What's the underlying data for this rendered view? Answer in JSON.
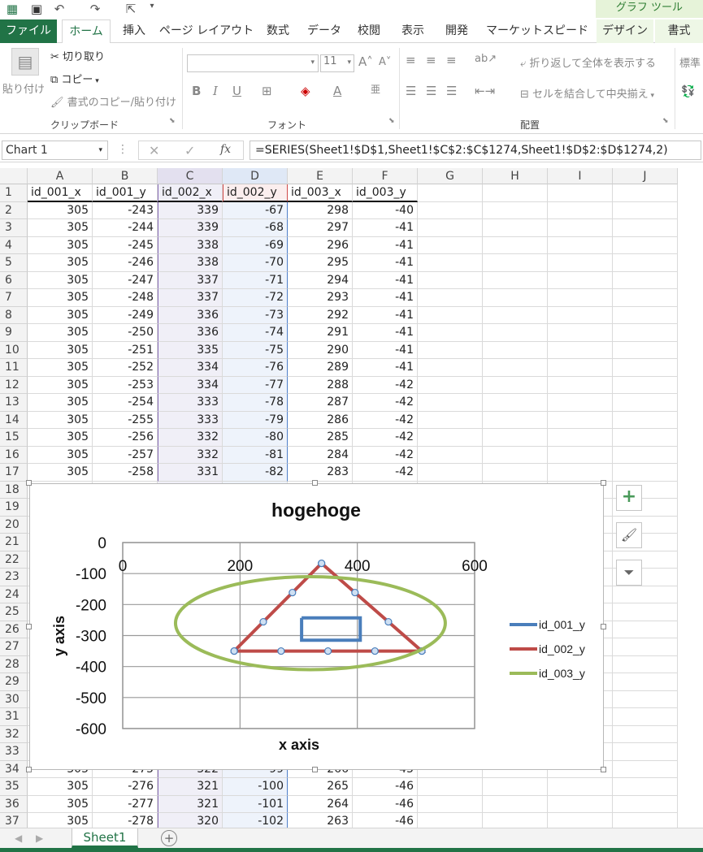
{
  "app": {
    "context_tab_group": "グラフ ツール"
  },
  "ribbon_tabs": [
    "ファイル",
    "ホーム",
    "挿入",
    "ページ レイアウト",
    "数式",
    "データ",
    "校閲",
    "表示",
    "開発",
    "マーケットスピード II",
    "デザイン",
    "書式"
  ],
  "ribbon": {
    "clipboard": {
      "paste": "貼り付け",
      "cut": "切り取り",
      "copy": "コピー",
      "format_painter": "書式のコピー/貼り付け",
      "label": "クリップボード"
    },
    "font": {
      "font_name": "",
      "font_size": "11",
      "label": "フォント"
    },
    "alignment": {
      "wrap_text": "折り返して全体を表示する",
      "merge_center": "セルを結合して中央揃え",
      "label": "配置"
    },
    "number": {
      "format": "標準"
    }
  },
  "formula_bar": {
    "name_box": "Chart 1",
    "fx": "fx",
    "formula": "=SERIES(Sheet1!$D$1,Sheet1!$C$2:$C$1274,Sheet1!$D$2:$D$1274,2)"
  },
  "columns": [
    "A",
    "B",
    "C",
    "D",
    "E",
    "F",
    "G",
    "H",
    "I",
    "J"
  ],
  "headers": [
    "id_001_x",
    "id_001_y",
    "id_002_x",
    "id_002_y",
    "id_003_x",
    "id_003_y"
  ],
  "rows_top": [
    {
      "n": "2",
      "v": [
        "305",
        "-243",
        "339",
        "-67",
        "298",
        "-40"
      ]
    },
    {
      "n": "3",
      "v": [
        "305",
        "-244",
        "339",
        "-68",
        "297",
        "-41"
      ]
    },
    {
      "n": "4",
      "v": [
        "305",
        "-245",
        "338",
        "-69",
        "296",
        "-41"
      ]
    },
    {
      "n": "5",
      "v": [
        "305",
        "-246",
        "338",
        "-70",
        "295",
        "-41"
      ]
    },
    {
      "n": "6",
      "v": [
        "305",
        "-247",
        "337",
        "-71",
        "294",
        "-41"
      ]
    },
    {
      "n": "7",
      "v": [
        "305",
        "-248",
        "337",
        "-72",
        "293",
        "-41"
      ]
    },
    {
      "n": "8",
      "v": [
        "305",
        "-249",
        "336",
        "-73",
        "292",
        "-41"
      ]
    },
    {
      "n": "9",
      "v": [
        "305",
        "-250",
        "336",
        "-74",
        "291",
        "-41"
      ]
    },
    {
      "n": "10",
      "v": [
        "305",
        "-251",
        "335",
        "-75",
        "290",
        "-41"
      ]
    },
    {
      "n": "11",
      "v": [
        "305",
        "-252",
        "334",
        "-76",
        "289",
        "-41"
      ]
    },
    {
      "n": "12",
      "v": [
        "305",
        "-253",
        "334",
        "-77",
        "288",
        "-42"
      ]
    },
    {
      "n": "13",
      "v": [
        "305",
        "-254",
        "333",
        "-78",
        "287",
        "-42"
      ]
    },
    {
      "n": "14",
      "v": [
        "305",
        "-255",
        "333",
        "-79",
        "286",
        "-42"
      ]
    },
    {
      "n": "15",
      "v": [
        "305",
        "-256",
        "332",
        "-80",
        "285",
        "-42"
      ]
    },
    {
      "n": "16",
      "v": [
        "305",
        "-257",
        "332",
        "-81",
        "284",
        "-42"
      ]
    },
    {
      "n": "17",
      "v": [
        "305",
        "-258",
        "331",
        "-82",
        "283",
        "-42"
      ]
    }
  ],
  "rows_hidden_numbers": [
    "18",
    "19",
    "20",
    "21",
    "22",
    "23",
    "24",
    "25",
    "26",
    "27",
    "28",
    "29",
    "30",
    "31",
    "32",
    "33"
  ],
  "rows_bottom": [
    {
      "n": "34",
      "v": [
        "305",
        "-275",
        "322",
        "-99",
        "266",
        "-45"
      ]
    },
    {
      "n": "35",
      "v": [
        "305",
        "-276",
        "321",
        "-100",
        "265",
        "-46"
      ]
    },
    {
      "n": "36",
      "v": [
        "305",
        "-277",
        "321",
        "-101",
        "264",
        "-46"
      ]
    },
    {
      "n": "37",
      "v": [
        "305",
        "-278",
        "320",
        "-102",
        "263",
        "-46"
      ]
    }
  ],
  "sheet_tabs": [
    "Sheet1"
  ],
  "chart_data": {
    "type": "scatter",
    "title": "hogehoge",
    "xlabel": "x axis",
    "ylabel": "y axis",
    "xlim": [
      0,
      600
    ],
    "ylim": [
      -600,
      0
    ],
    "x_ticks": [
      0,
      200,
      400,
      600
    ],
    "y_ticks": [
      0,
      -100,
      -200,
      -300,
      -400,
      -500,
      -600
    ],
    "grid": true,
    "legend_position": "right",
    "series": [
      {
        "name": "id_001_y",
        "color": "#4a7ebb",
        "x": [
          305,
          305,
          405,
          405,
          305
        ],
        "y": [
          -243,
          -315,
          -315,
          -243,
          -243
        ]
      },
      {
        "name": "id_002_y",
        "color": "#be4b48",
        "marker": "circle",
        "x": [
          339,
          190,
          510,
          339
        ],
        "y": [
          -67,
          -350,
          -350,
          -67
        ]
      },
      {
        "name": "id_003_y",
        "color": "#9bbb59",
        "type": "ellipse",
        "cx": 320,
        "cy": -260,
        "rx": 230,
        "ry": 150
      }
    ]
  }
}
